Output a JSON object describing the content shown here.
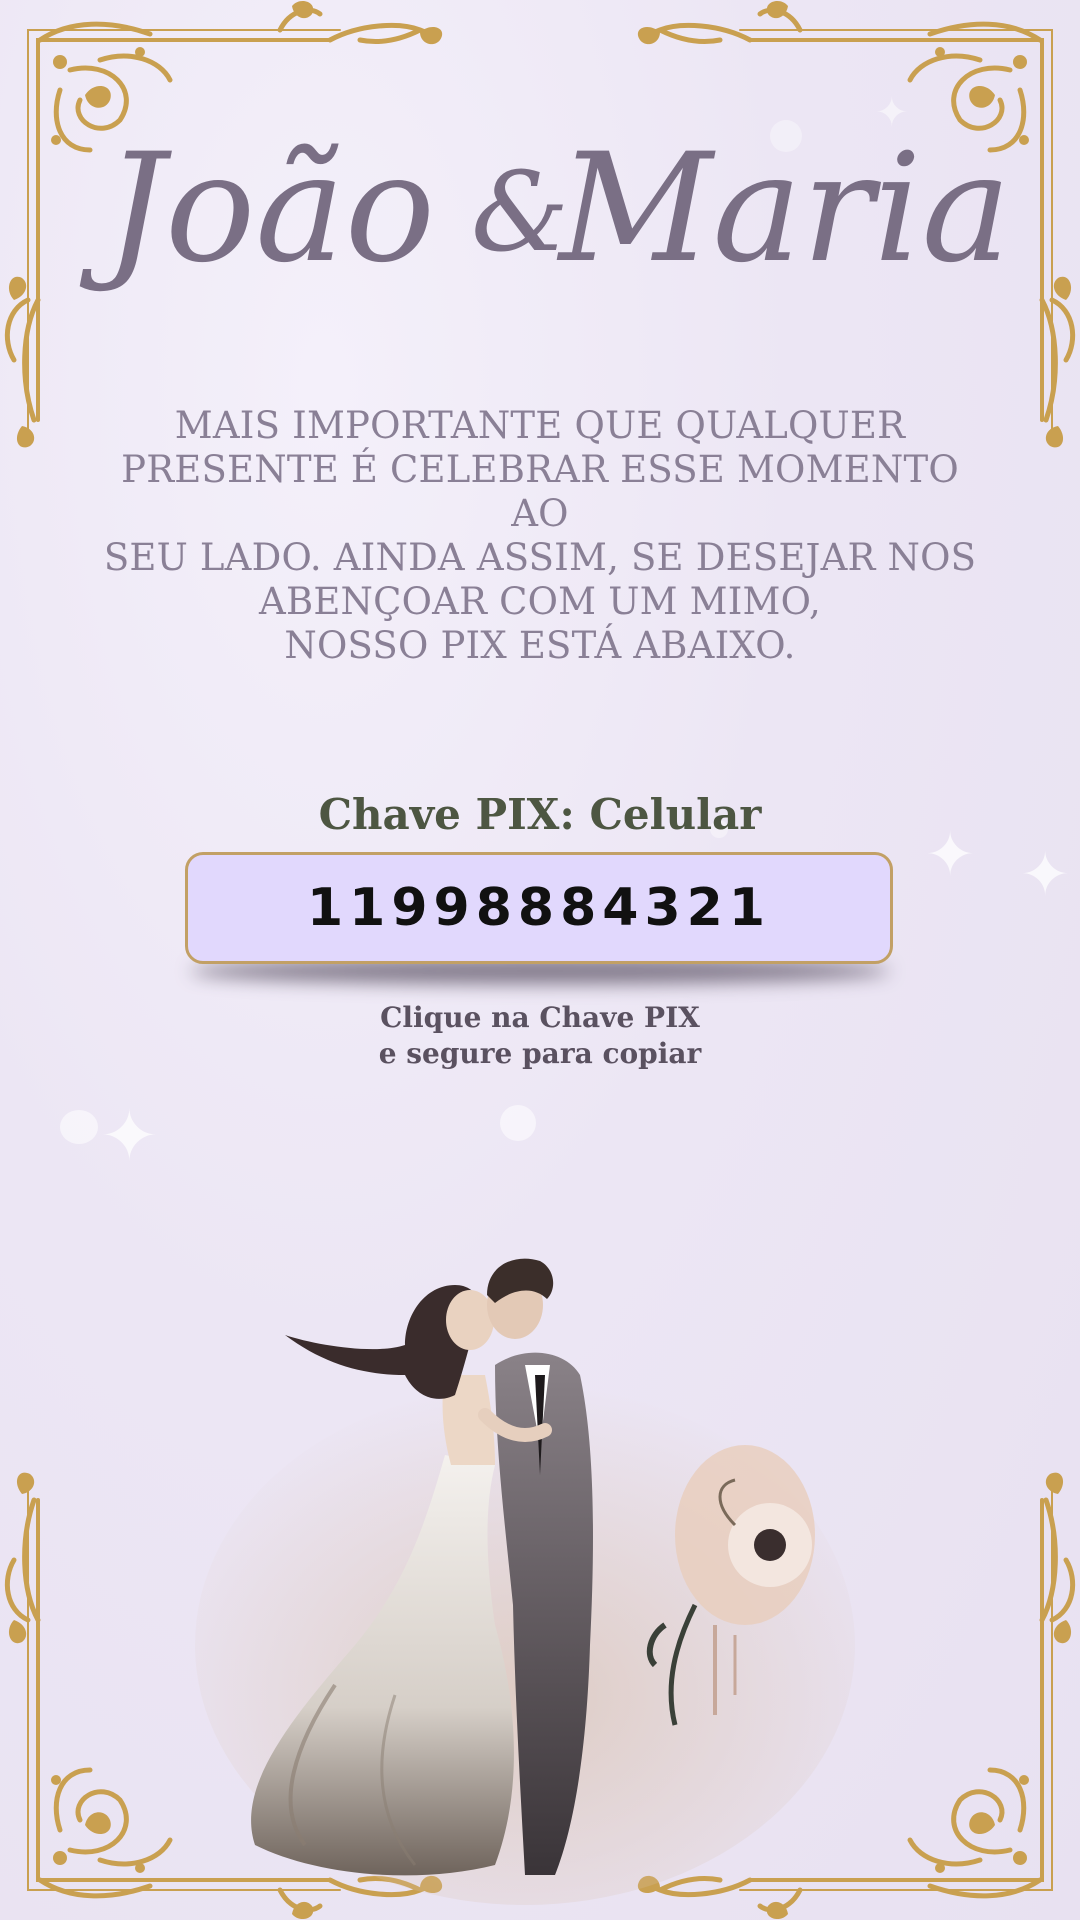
{
  "invitation": {
    "names": {
      "bride_groom_first": "João",
      "ampersand": "&",
      "second": "Maria"
    },
    "message_lines": [
      "MAIS IMPORTANTE QUE QUALQUER",
      "PRESENTE É CELEBRAR ESSE MOMENTO AO",
      "SEU LADO. AINDA ASSIM, SE DESEJAR NOS",
      "ABENÇOAR COM UM MIMO,",
      "NOSSO PIX ESTÁ ABAIXO."
    ],
    "pix": {
      "label": "Chave PIX: Celular",
      "value": "11998884321"
    },
    "hint_lines": [
      "Clique na Chave PIX",
      "e segure para copiar"
    ]
  },
  "colors": {
    "background": "#ece6f4",
    "gold_frame": "#c9a050",
    "names": "#7a6f85",
    "message": "#8a8096",
    "pix_label": "#4d5642",
    "pix_box_fill": "#e1d8fd",
    "pix_box_border": "#c2a065",
    "pix_value": "#111111",
    "hint": "#5a5160"
  },
  "icons": {
    "frame_corners": "ornate-gold-corner-icon",
    "illustration": "wedding-couple-illustration"
  }
}
